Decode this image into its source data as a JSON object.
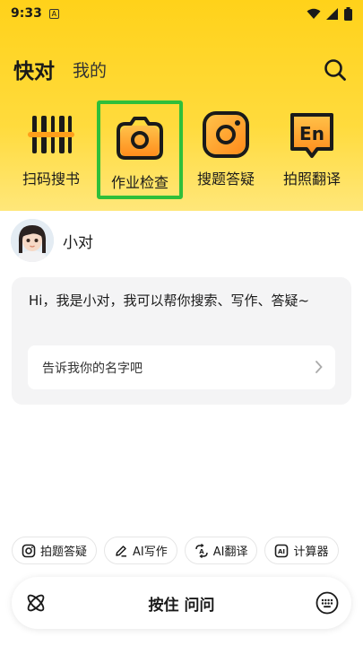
{
  "status_bar": {
    "time": "9:33",
    "notification_letter": "A"
  },
  "header": {
    "title": "快对",
    "tab_mine": "我的"
  },
  "tools": [
    {
      "label": "扫码搜书",
      "icon": "barcode-scan-icon"
    },
    {
      "label": "作业检查",
      "icon": "camera-icon",
      "highlighted": true
    },
    {
      "label": "搜题答疑",
      "icon": "camera-search-icon"
    },
    {
      "label": "拍照翻译",
      "icon": "en-translate-icon"
    }
  ],
  "assistant": {
    "name": "小对",
    "greeting": "Hi，我是小对，我可以帮你搜索、写作、答疑~",
    "suggestion": "告诉我你的名字吧"
  },
  "quick_actions": [
    {
      "label": "拍题答疑",
      "icon": "camera-icon"
    },
    {
      "label": "AI写作",
      "icon": "pen-icon"
    },
    {
      "label": "AI翻译",
      "icon": "translate-icon"
    },
    {
      "label": "计算器",
      "icon": "ai-calculator-icon"
    }
  ],
  "voice_bar": {
    "label": "按住 问问"
  },
  "colors": {
    "brand_yellow": "#ffd21a",
    "highlight_green": "#2fbf3a",
    "icon_orange": "#ff9f1a"
  }
}
